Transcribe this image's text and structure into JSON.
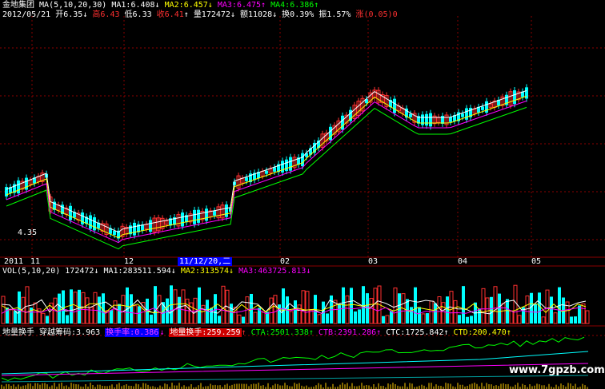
{
  "header": {
    "stock_name": "金地集团",
    "ma_label": "MA(5,10,20,30)",
    "ma1": "MA1:6.408",
    "ma2": "MA2:6.457",
    "ma3": "MA3:6.475",
    "ma4": "MA4:6.386",
    "date": "2012/05/21",
    "open": "开6.35",
    "high": "高6.43",
    "low": "低6.33",
    "close": "收6.41",
    "volume": "量172472",
    "amount": "额11028",
    "turnover": "换0.39%",
    "amplitude": "振1.57%",
    "change": "涨(0.05)0"
  },
  "price_panel": {
    "price_low_marker": "4.35",
    "cursor_date": "11/12/20,二"
  },
  "time_axis": [
    "2011",
    "11",
    "12",
    "02",
    "03",
    "04",
    "05"
  ],
  "volume_panel": {
    "label": "VOL(5,10,20)",
    "value": "172472",
    "ma1": "MA1:283511.594",
    "ma2": "MA2:313574",
    "ma3": "MA3:463725.813"
  },
  "chip_panel": {
    "title": "地量换手",
    "chip_label": "穿越筹码:3.963",
    "turnover_rate": "换手率:0.386",
    "low_volume_turnover": "地量换手:259.259",
    "cta": "CTA:2501.338",
    "ctb": "CTB:2391.286",
    "ctc": "CTC:1725.842",
    "ctd": "CTD:200.470"
  },
  "watermark": "www.7gpzb.com",
  "colors": {
    "up": "#ff3030",
    "down": "#00ffff",
    "ma1": "#ffffff",
    "ma2": "#ffff00",
    "ma3": "#ff00ff",
    "ma4": "#00ff00",
    "grid": "#8b0000"
  }
}
